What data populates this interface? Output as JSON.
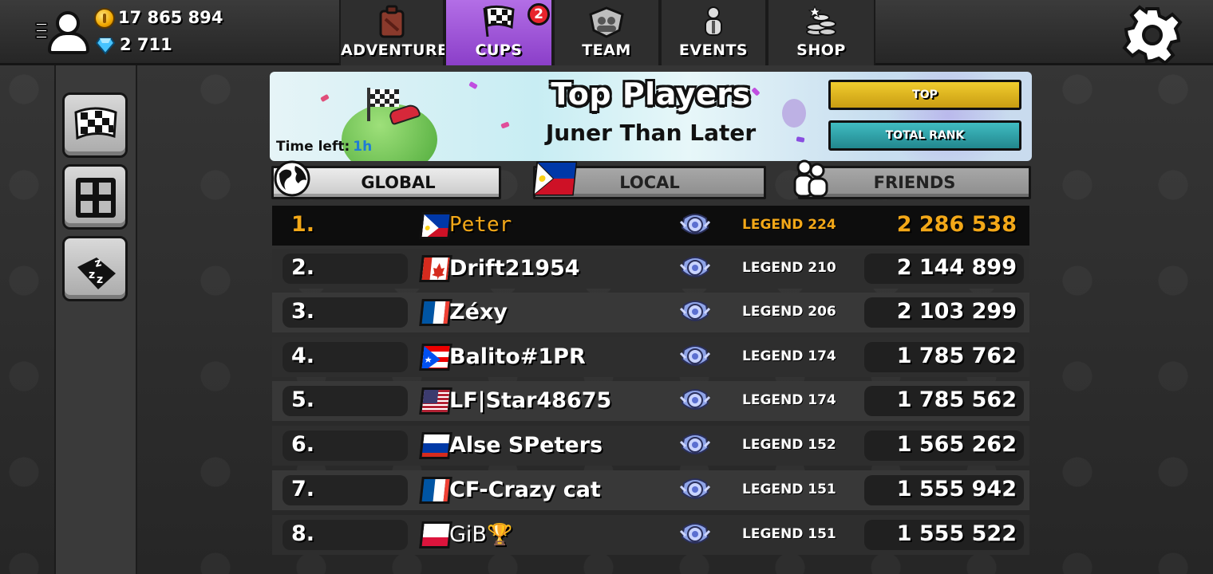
{
  "topbar": {
    "coins": "17 865 894",
    "gems": "2 711",
    "tabs": [
      {
        "label": "ADVENTURE",
        "icon": "fuel-can-icon"
      },
      {
        "label": "CUPS",
        "icon": "checkered-flag-icon",
        "badge": "2",
        "active": true
      },
      {
        "label": "TEAM",
        "icon": "team-emblem-icon"
      },
      {
        "label": "EVENTS",
        "icon": "event-people-icon"
      },
      {
        "label": "SHOP",
        "icon": "coin-stack-icon"
      }
    ]
  },
  "side_buttons": [
    "checkered-flag-icon",
    "grid-icon",
    "zzz-sleep-icon"
  ],
  "banner": {
    "title": "Top Players",
    "subtitle": "Juner Than Later",
    "time_left_label": "Time left:",
    "time_left_value": "1h",
    "top_button": "TOP",
    "total_rank_button": "TOTAL RANK"
  },
  "filters": {
    "global": "GLOBAL",
    "local": "LOCAL",
    "friends": "FRIENDS"
  },
  "leaderboard": [
    {
      "rank": "1.",
      "name": "Peter",
      "flag": "philippines",
      "league": "LEGEND 224",
      "score": "2 286 538",
      "highlight": true
    },
    {
      "rank": "2.",
      "name": "Drift21954",
      "flag": "canada",
      "league": "LEGEND 210",
      "score": "2 144 899"
    },
    {
      "rank": "3.",
      "name": "Zéxy",
      "flag": "france",
      "league": "LEGEND 206",
      "score": "2 103 299"
    },
    {
      "rank": "4.",
      "name": "Balito#1PR",
      "flag": "puerto-rico",
      "league": "LEGEND 174",
      "score": "1 785 762"
    },
    {
      "rank": "5.",
      "name": "LF|Star48675",
      "flag": "usa",
      "league": "LEGEND 174",
      "score": "1 785 562"
    },
    {
      "rank": "6.",
      "name": "Alse SPeters",
      "flag": "russia",
      "league": "LEGEND 152",
      "score": "1 565 262"
    },
    {
      "rank": "7.",
      "name": "CF-Crazy cat",
      "flag": "france",
      "league": "LEGEND 151",
      "score": "1 555 942"
    },
    {
      "rank": "8.",
      "name": "GiB",
      "name_suffix": "🏆",
      "flag": "poland",
      "league": "LEGEND 151",
      "score": "1 555 522"
    }
  ],
  "colors": {
    "active_tab": "#9a4fd6",
    "highlight_text": "#f3a818",
    "top_button": "#e2b91f",
    "total_rank_button": "#2fa3aa",
    "time_left_value": "#1e7cd6"
  }
}
